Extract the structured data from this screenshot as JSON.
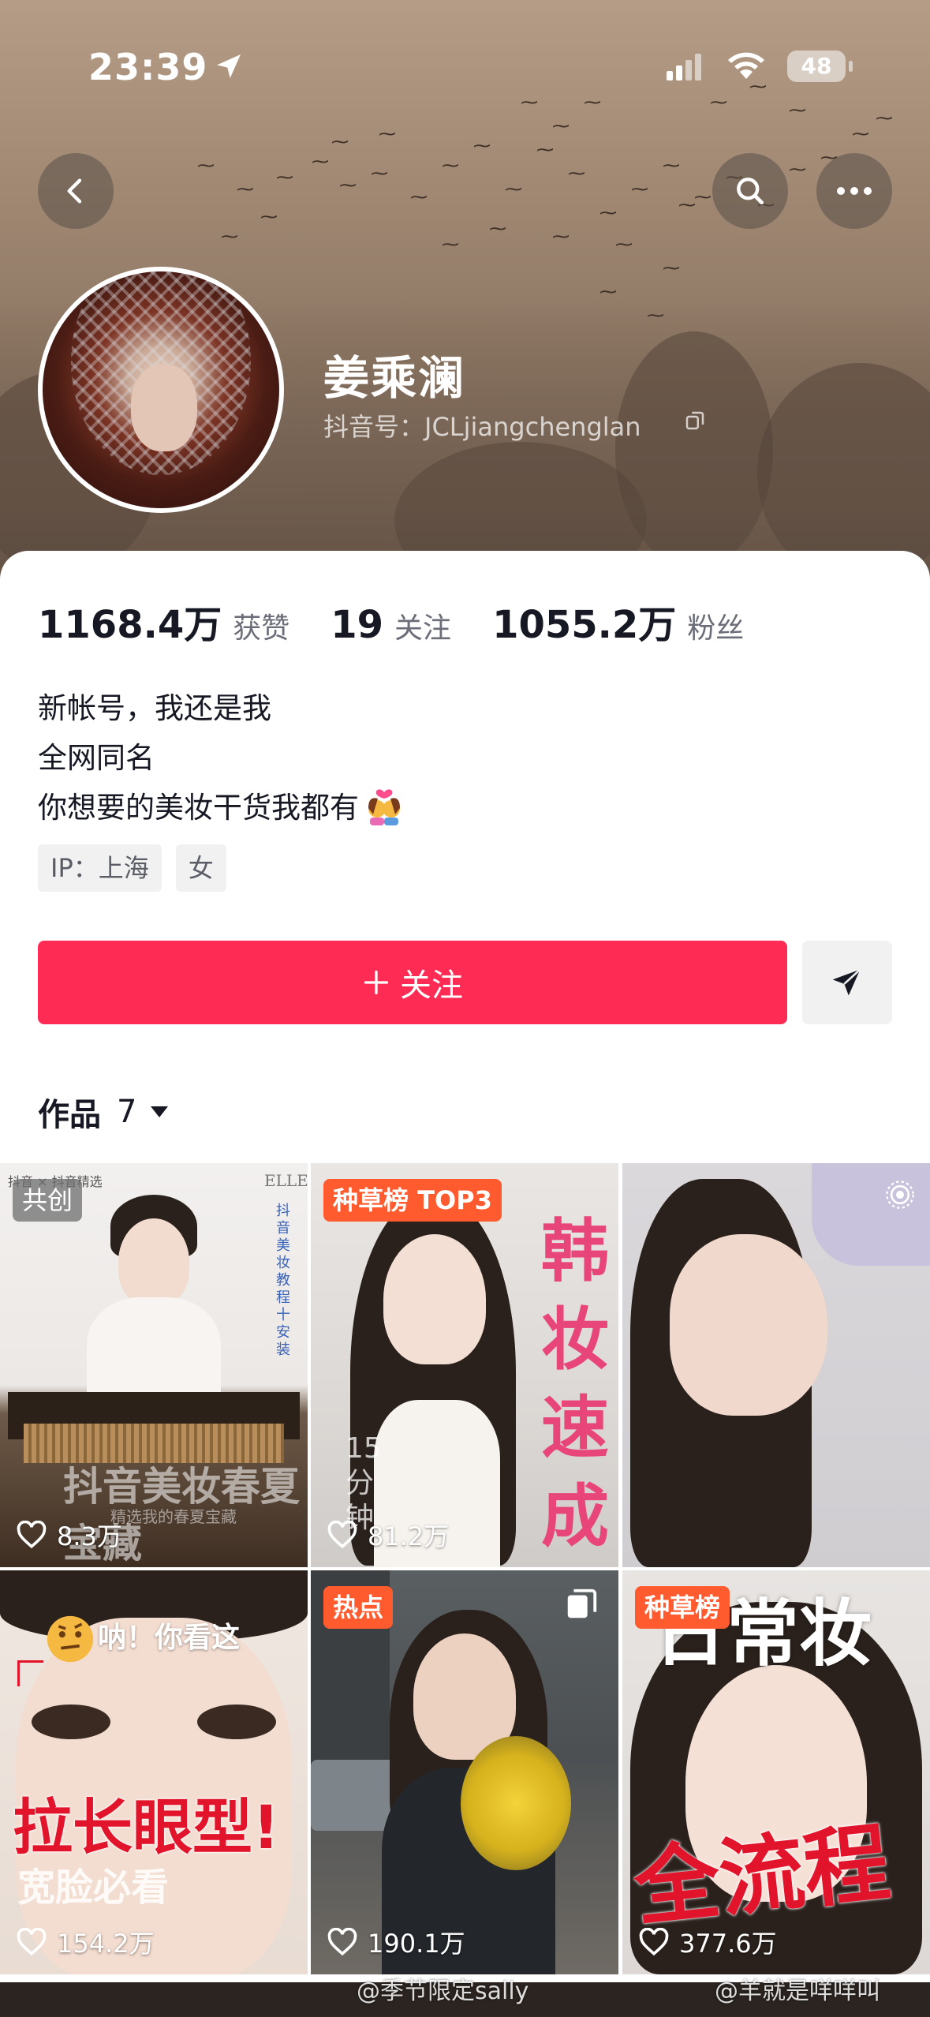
{
  "status_bar": {
    "time": "23:39",
    "battery": "48"
  },
  "profile": {
    "name": "姜乘澜",
    "douyin_id": "抖音号：JCLjiangchenglan",
    "stats": [
      {
        "value": "1168.4万",
        "label": "获赞"
      },
      {
        "value": "19",
        "label": "关注"
      },
      {
        "value": "1055.2万",
        "label": "粉丝"
      }
    ],
    "bio": [
      "新帐号，我还是我",
      "全网同名",
      "你想要的美妆干货我都有"
    ],
    "tags": [
      "IP：上海",
      "女"
    ]
  },
  "actions": {
    "follow_label": "关注"
  },
  "works": {
    "label": "作品",
    "count": "7"
  },
  "videos": [
    {
      "badge": "共创",
      "likes": "8.3万",
      "overlay": "抖音美妆春夏宝藏",
      "top_left": "抖音 × 抖音精选",
      "top_right": "ELLE",
      "side": "抖音美妆教程十安装",
      "caption": "抖音美妆春夏宝藏",
      "sub": "精选我的春夏宝藏"
    },
    {
      "badge": "种草榜 TOP3",
      "likes": "81.2万",
      "overlay": "韩妆速成",
      "side": "15分钟"
    },
    {
      "likes": ""
    },
    {
      "likes": "154.2万",
      "overlay_top": "呐！你看这",
      "overlay_main": "拉长眼型!",
      "overlay_sub": "宽脸必看"
    },
    {
      "badge": "热点",
      "likes": "190.1万"
    },
    {
      "badge": "种草榜",
      "likes": "377.6万",
      "overlay_top": "日常妆",
      "overlay_main": "全流程"
    }
  ],
  "watermarks": [
    "@季节限定sally",
    "@羊就是咩咩叫"
  ],
  "colors": {
    "accent": "#fe2c55",
    "badge_orange": "#ff5b2e",
    "banner": "#9e8671"
  }
}
